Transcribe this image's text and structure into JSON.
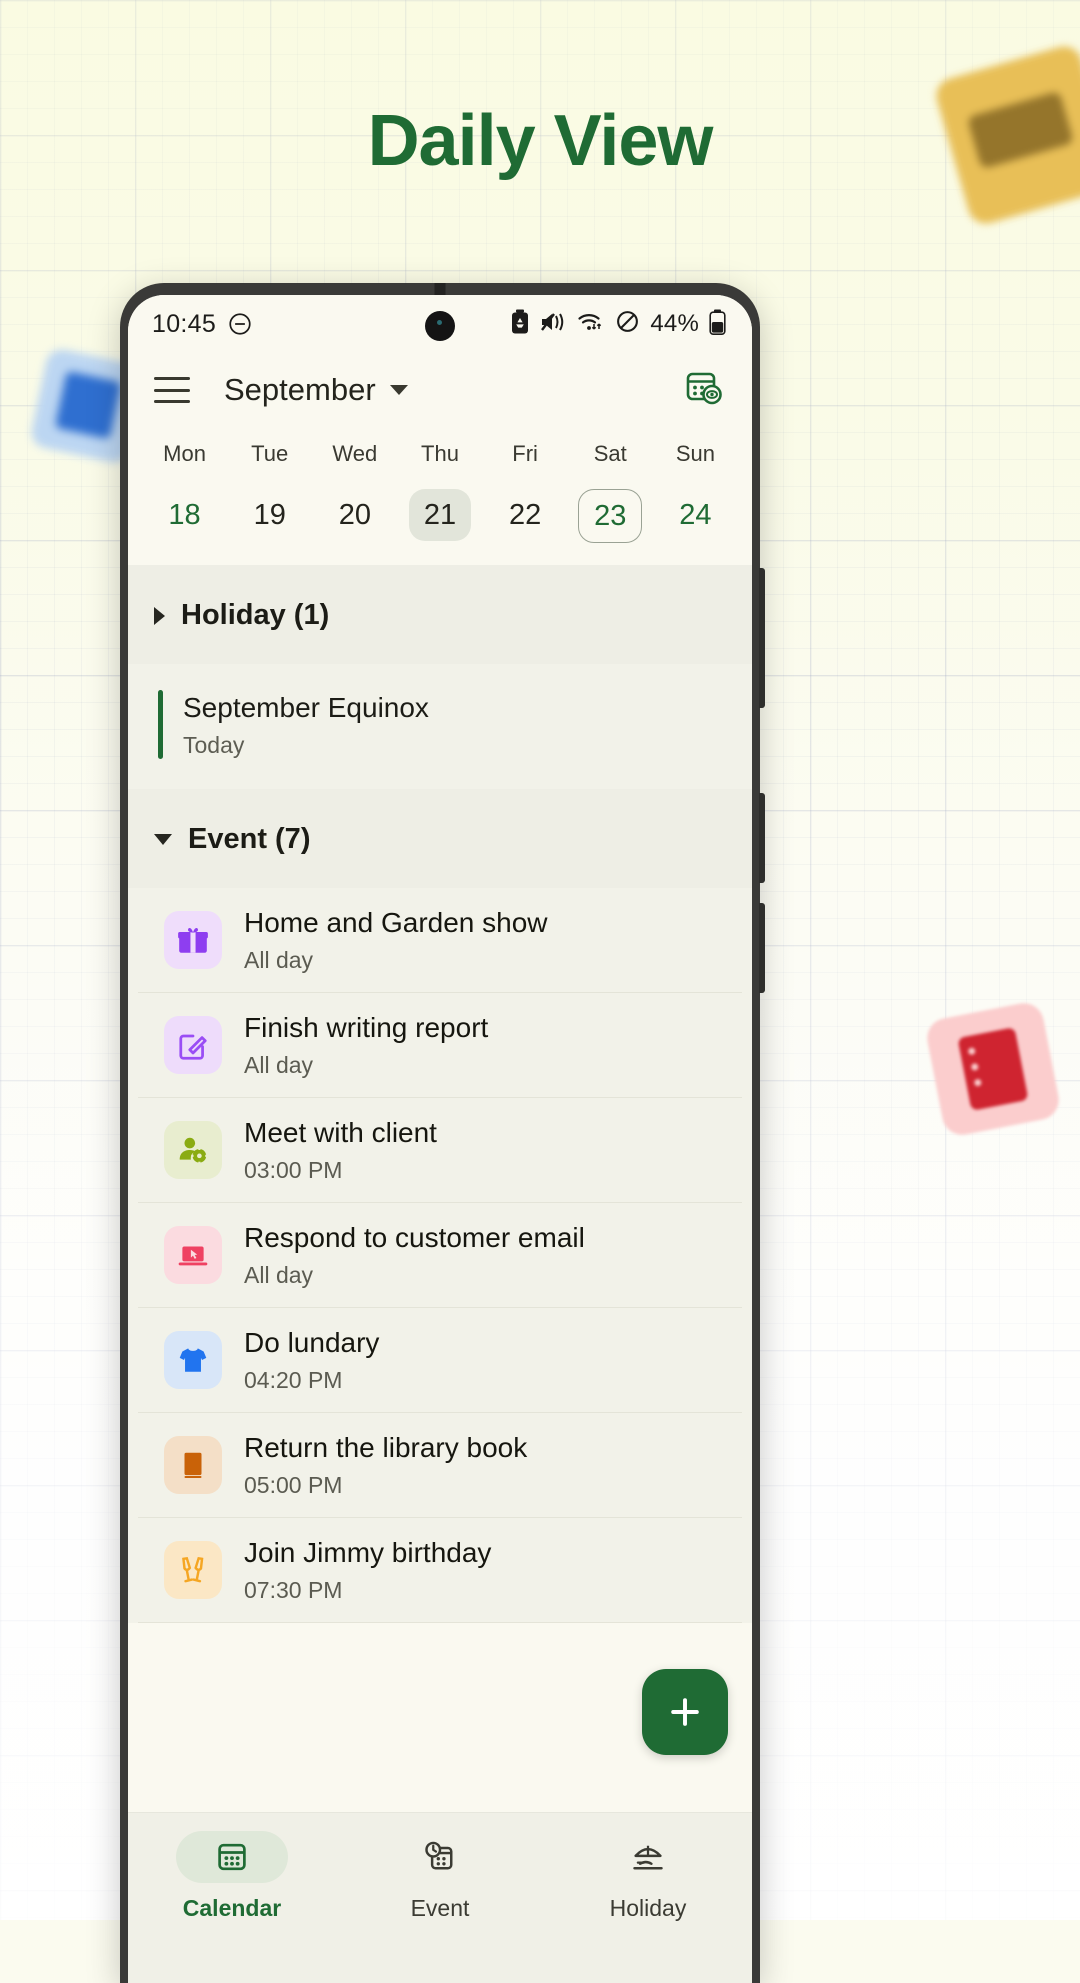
{
  "page": {
    "title": "Daily View"
  },
  "statusbar": {
    "time": "10:45",
    "dnd_icon": "do-not-disturb-icon",
    "battery_saver_icon": "battery-recycle-icon",
    "sound_icon": "mute-vibrate-icon",
    "wifi_icon": "wifi-icon",
    "signal_icon": "no-signal-icon",
    "battery_percent": "44%",
    "battery_icon": "battery-icon"
  },
  "appbar": {
    "menu_icon": "hamburger-menu-icon",
    "month": "September",
    "dropdown_icon": "chevron-down-icon",
    "view_icon": "calendar-eye-icon"
  },
  "week": {
    "days": [
      {
        "dow": "Mon",
        "date": "18",
        "green": true,
        "selected": false,
        "today": false
      },
      {
        "dow": "Tue",
        "date": "19",
        "green": false,
        "selected": false,
        "today": false
      },
      {
        "dow": "Wed",
        "date": "20",
        "green": false,
        "selected": false,
        "today": false
      },
      {
        "dow": "Thu",
        "date": "21",
        "green": false,
        "selected": true,
        "today": false
      },
      {
        "dow": "Fri",
        "date": "22",
        "green": false,
        "selected": false,
        "today": false
      },
      {
        "dow": "Sat",
        "date": "23",
        "green": true,
        "selected": false,
        "today": true
      },
      {
        "dow": "Sun",
        "date": "24",
        "green": true,
        "selected": false,
        "today": false
      }
    ]
  },
  "sections": {
    "holiday": {
      "label": "Holiday (1)",
      "expanded": false,
      "items": [
        {
          "title": "September Equinox",
          "subtitle": "Today"
        }
      ]
    },
    "event": {
      "label": "Event (7)",
      "expanded": true,
      "items": [
        {
          "title": "Home and Garden show",
          "time": "All day",
          "icon": "gift-icon",
          "icon_bg": "#efddfb",
          "icon_color": "#8e3ef0"
        },
        {
          "title": "Finish writing report",
          "time": "All day",
          "icon": "edit-square-icon",
          "icon_bg": "#eedcfb",
          "icon_color": "#9a4df5"
        },
        {
          "title": "Meet with client",
          "time": "03:00 PM",
          "icon": "person-gear-icon",
          "icon_bg": "#e8edcf",
          "icon_color": "#8aab12"
        },
        {
          "title": "Respond to customer email",
          "time": "All day",
          "icon": "laptop-cursor-icon",
          "icon_bg": "#fbdbe0",
          "icon_color": "#ef4162"
        },
        {
          "title": "Do lundary",
          "time": "04:20 PM",
          "icon": "tshirt-icon",
          "icon_bg": "#d8e6f8",
          "icon_color": "#2174ef"
        },
        {
          "title": "Return the library book",
          "time": "05:00 PM",
          "icon": "book-icon",
          "icon_bg": "#f4dfc7",
          "icon_color": "#c96208"
        },
        {
          "title": "Join Jimmy birthday",
          "time": "07:30 PM",
          "icon": "cheers-icon",
          "icon_bg": "#fbe7c5",
          "icon_color": "#f5a623"
        }
      ]
    }
  },
  "fab": {
    "icon": "plus-icon",
    "label": "+",
    "color": "#1f6b34"
  },
  "bottomnav": {
    "items": [
      {
        "label": "Calendar",
        "icon": "calendar-icon",
        "active": true
      },
      {
        "label": "Event",
        "icon": "event-clock-icon",
        "active": false
      },
      {
        "label": "Holiday",
        "icon": "beach-umbrella-icon",
        "active": false
      }
    ]
  },
  "colors": {
    "brand_green": "#1f6b34",
    "page_bg": "#fafbe4"
  }
}
